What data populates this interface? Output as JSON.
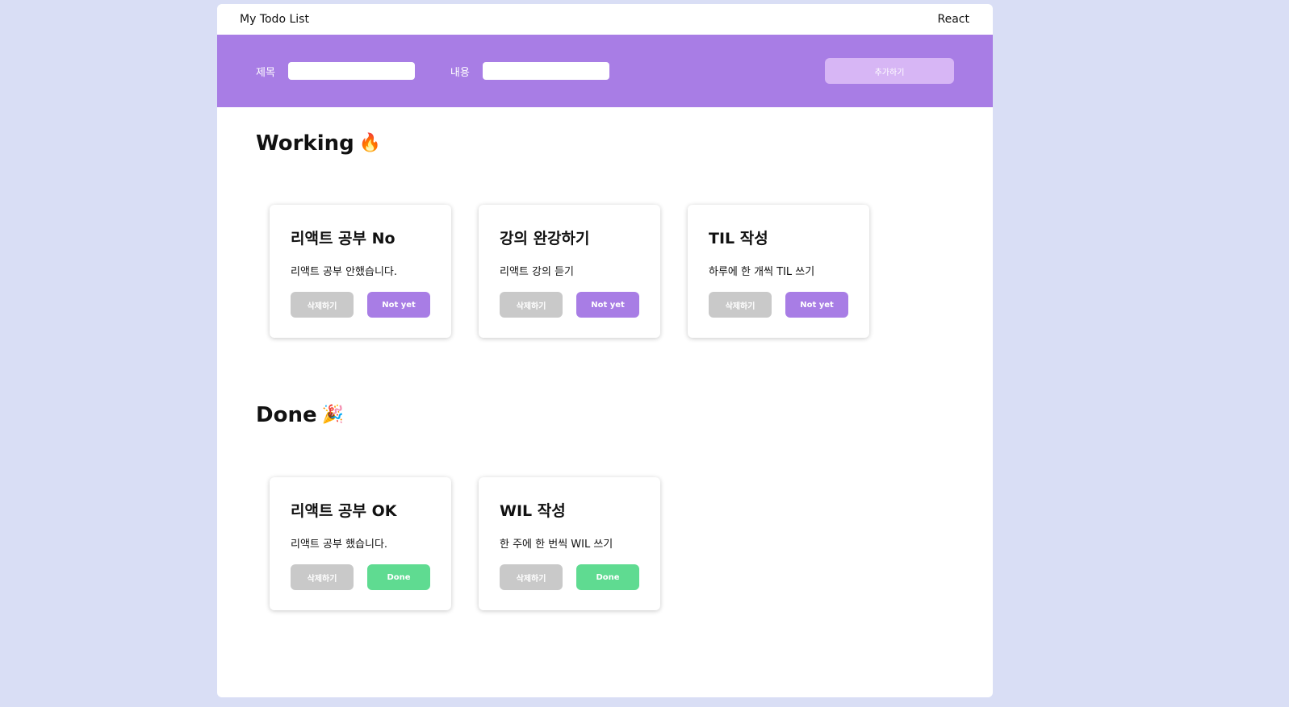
{
  "header": {
    "title": "My Todo List",
    "right_text": "React"
  },
  "form": {
    "title_label": "제목",
    "content_label": "내용",
    "title_value": "",
    "content_value": "",
    "submit_label": "추가하기"
  },
  "sections": {
    "working": {
      "title": "Working",
      "icon": "fire-icon",
      "emoji": "🔥"
    },
    "done": {
      "title": "Done",
      "icon": "party-popper-icon",
      "emoji": "🎉"
    }
  },
  "working_todos": [
    {
      "title": "리액트 공부 No",
      "body": "리액트 공부 안했습니다.",
      "delete_label": "삭제하기",
      "toggle_label": "Not yet"
    },
    {
      "title": "강의 완강하기",
      "body": "리액트 강의 듣기",
      "delete_label": "삭제하기",
      "toggle_label": "Not yet"
    },
    {
      "title": "TIL 작성",
      "body": "하루에 한 개씩 TIL 쓰기",
      "delete_label": "삭제하기",
      "toggle_label": "Not yet"
    }
  ],
  "done_todos": [
    {
      "title": "리액트 공부 OK",
      "body": "리액트 공부 했습니다.",
      "delete_label": "삭제하기",
      "toggle_label": "Done"
    },
    {
      "title": "WIL 작성",
      "body": "한 주에 한 번씩 WIL 쓰기",
      "delete_label": "삭제하기",
      "toggle_label": "Done"
    }
  ],
  "colors": {
    "page_background": "#d9def5",
    "accent": "#a87de5",
    "add_button": "#d7b6f5",
    "done_green": "#5fdb91",
    "delete_gray": "#c9c9c9"
  }
}
